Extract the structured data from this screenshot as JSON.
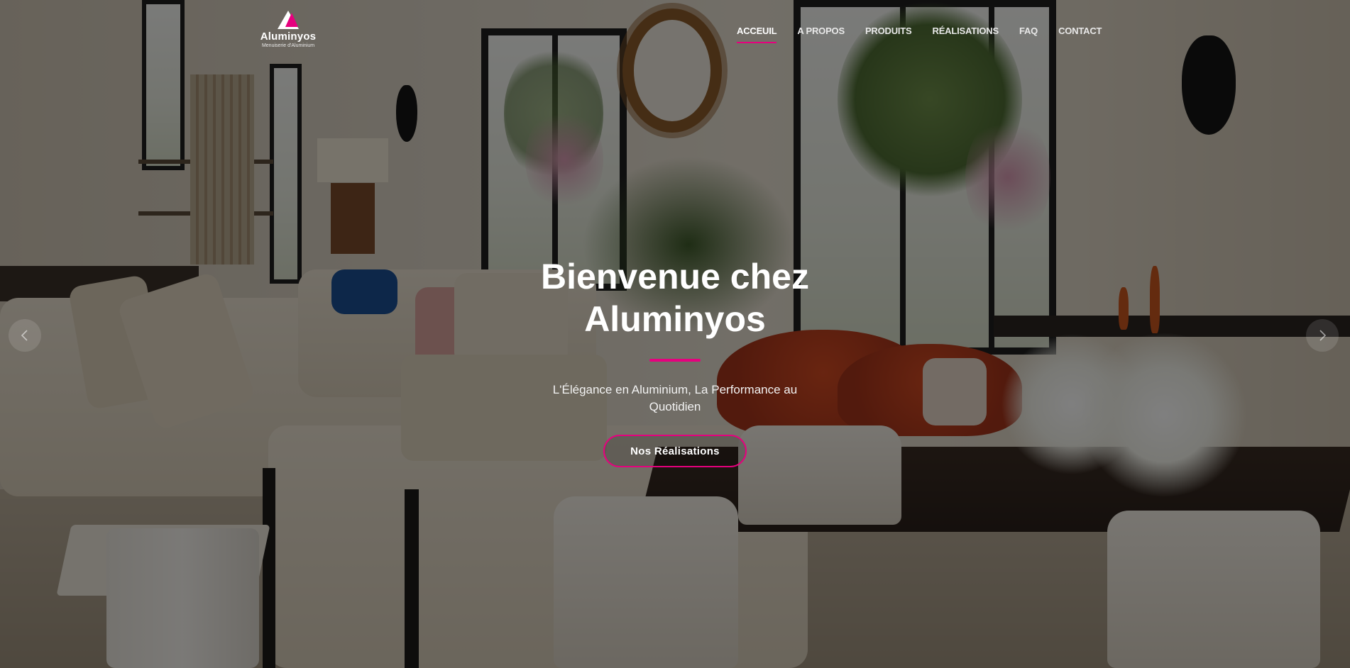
{
  "brand": {
    "name": "Aluminyos",
    "tagline": "Menuiserie d'Aluminium",
    "logo_icon": "logo-a-icon",
    "accent_color": "#e6007e"
  },
  "nav": {
    "items": [
      {
        "label": "ACCEUIL",
        "active": true
      },
      {
        "label": "A PROPOS",
        "active": false
      },
      {
        "label": "PRODUITS",
        "active": false
      },
      {
        "label": "RÉALISATIONS",
        "active": false
      },
      {
        "label": "FAQ",
        "active": false
      },
      {
        "label": "CONTACT",
        "active": false
      }
    ]
  },
  "hero": {
    "title_line1": "Bienvenue chez",
    "title_line2": "Aluminyos",
    "subtitle": "L'Élégance en Aluminium, La Performance au Quotidien",
    "cta_label": "Nos Réalisations",
    "prev_icon": "chevron-left-icon",
    "next_icon": "chevron-right-icon"
  }
}
